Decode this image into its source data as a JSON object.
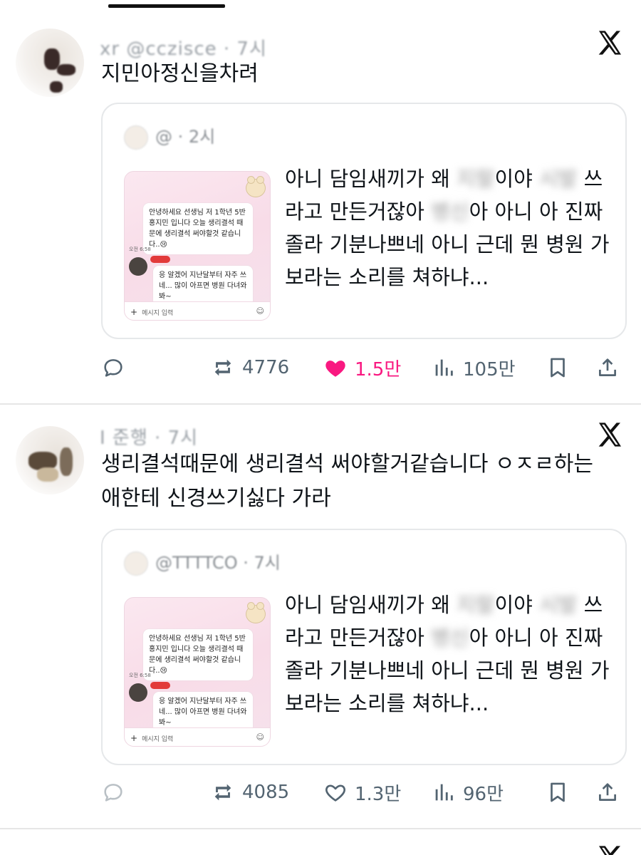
{
  "colors": {
    "like_active": "#f91880",
    "icon_gray": "#536471",
    "text": "#0f1419",
    "border": "#e6e8ea"
  },
  "icons": {
    "logo": "x-logo-icon",
    "reply": "comment-icon",
    "repost": "repost-icon",
    "like": "heart-icon",
    "views": "bar-chart-icon",
    "bookmark": "bookmark-icon",
    "share": "share-icon"
  },
  "tweets": [
    {
      "handle": "xr @cczisce · 7시",
      "text": "지민아정신을차려",
      "quote": {
        "header": "@ · 2시",
        "image_chat": {
          "msg1": "안녕하세요 선생님 저 1학년 5반 홍지민 입니다 오늘 생리결석 때문에 생리결석 써야할것 같습니다..😢",
          "time": "오전 6:58",
          "msg2": "응 알겠어 지난달부터 자주 쓰네... 많이 아프면 병원 다녀와봐~",
          "input_placeholder": "메시지 입력"
        },
        "text_parts": [
          "아니 담임새끼가 왜 ",
          "지랄",
          "이야 ",
          "시발",
          " 쓰라고 만든거잖아 ",
          "병신",
          "아 아니 아 진짜 졸라 기분나쁘네 아니 근데 뭔 병원 가보라는 소리를 쳐하냐..."
        ]
      },
      "stats": {
        "retweets": "4776",
        "likes": "1.5만",
        "views": "105만",
        "liked": true
      }
    },
    {
      "handle": "I 준행 · 7시",
      "text": "생리결석때문에 생리결석 써야할거같습니다 ㅇㅈㄹ하는애한테 신경쓰기싫다 가라",
      "quote": {
        "header": "@TTTTCO · 7시",
        "image_chat": {
          "msg1": "안녕하세요 선생님 저 1학년 5반 홍지민 입니다 오늘 생리결석 때문에 생리결석 써야할것 같습니다..😢",
          "time": "오전 6:58",
          "msg2": "응 알겠어 지난달부터 자주 쓰네... 많이 아프면 병원 다녀와봐~",
          "input_placeholder": "메시지 입력"
        },
        "text_parts": [
          "아니 담임새끼가 왜 ",
          "지랄",
          "이야 ",
          "시발",
          " 쓰라고 만든거잖아 ",
          "병신",
          "아 아니 아 진짜 졸라 기분나쁘네 아니 근데 뭔 병원 가보라는 소리를 쳐하냐..."
        ]
      },
      "stats": {
        "retweets": "4085",
        "likes": "1.3만",
        "views": "96만",
        "liked": false
      }
    }
  ]
}
